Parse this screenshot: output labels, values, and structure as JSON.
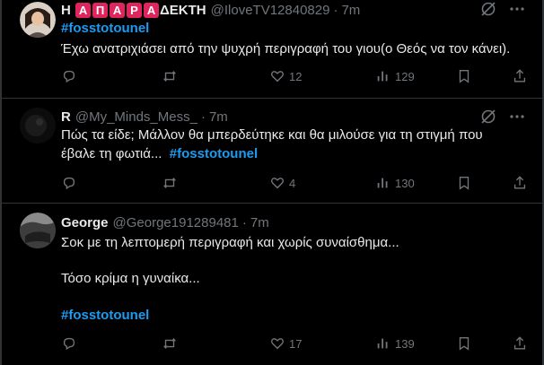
{
  "tweets": [
    {
      "name_prefix": "Η",
      "name_badges": [
        "Α",
        "Π",
        "Α",
        "Ρ",
        "Α"
      ],
      "name_suffix": "ΔΕΚΤΗ",
      "handle": "@IloveTV12840829",
      "dot": "·",
      "time": "7m",
      "hashtag": "#fosstotounel",
      "text": "Έχω ανατριχιάσει από την ψυχρή περιγραφή του γιου(ο Θεός να τον κάνει).",
      "likes": "12",
      "views": "129"
    },
    {
      "name": "R",
      "handle": "@My_Minds_Mess_",
      "dot": "·",
      "time": "7m",
      "line1": "Πώς τα είδε; Μάλλον θα μπερδεύτηκε και θα μιλούσε για τη στιγμή που",
      "line2": "έβαλε τη φωτιά...",
      "hashtag": "#fosstotounel",
      "likes": "4",
      "views": "130"
    },
    {
      "name": "George",
      "handle": "@George191289481",
      "dot": "·",
      "time": "7m",
      "line1": "Σοκ με τη λεπτομερή περιγραφή και χωρίς συναίσθημα...",
      "line2": "Τόσο κρίμα η γυναίκα...",
      "hashtag": "#fosstotounel",
      "likes": "17",
      "views": "139"
    }
  ]
}
